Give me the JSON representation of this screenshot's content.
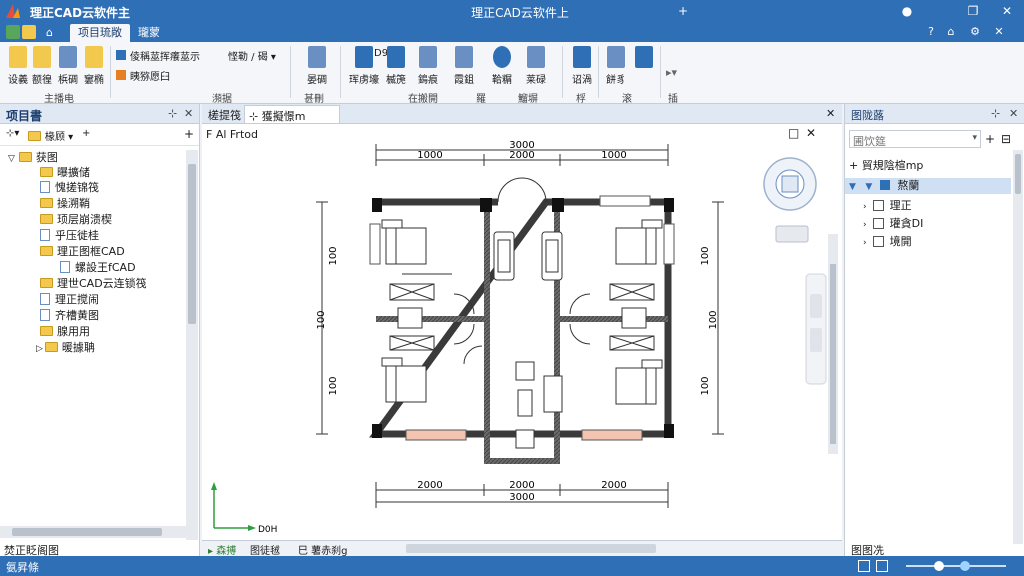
{
  "window": {
    "app_title": "理正CAD云软件主",
    "center_title": "理正CAD云软件上",
    "controls": {
      "pin": "+",
      "minimize": "●",
      "restore": "❐",
      "close": "✕"
    }
  },
  "tabs": {
    "home_icon": "⌂",
    "items": [
      "项目琉敞",
      "瓏蒙"
    ]
  },
  "ribbon": {
    "buttons": [
      {
        "label": "设義",
        "color": "#f2c94c"
      },
      {
        "label": "额徨",
        "color": "#f2c94c"
      },
      {
        "label": "梹碉",
        "color": "#6a8fc2"
      },
      {
        "label": "窶椭",
        "color": "#f2c94c"
      },
      {
        "label": "晏碉",
        "color": "#6a8fc2"
      },
      {
        "label": "珲虏壕",
        "color": "#2f6fb6"
      },
      {
        "label": "楲箎",
        "color": "#2f6fb6"
      },
      {
        "label": "鵭痕",
        "color": "#6a8fc2"
      },
      {
        "label": "霞鉏",
        "color": "#6a8fc2"
      },
      {
        "label": "鞈糏",
        "color": "#2f6fb6"
      },
      {
        "label": "莱碌",
        "color": "#6a8fc2"
      },
      {
        "label": "诏渦",
        "color": "#2f6fb6"
      },
      {
        "label": "餅豸",
        "color": "#6a8fc2"
      }
    ],
    "small_rows": [
      "倰稱莁挥癢莁示",
      "眱猕愿臼",
      "悭勒 / 碣 ▾",
      "D98"
    ],
    "groups": [
      "主播电",
      "瀕据",
      "甚刪",
      "在搬開",
      "羅",
      "鰡塀",
      "桴",
      "滚",
      "插"
    ]
  },
  "left_panel": {
    "title": "项目書",
    "toolbar_label": "椽顾",
    "tree": [
      {
        "label": "获图",
        "type": "folder",
        "depth": 0
      },
      {
        "label": "曝擴储",
        "type": "folder",
        "depth": 1
      },
      {
        "label": "愧搓锦筏",
        "type": "doc",
        "depth": 1
      },
      {
        "label": "操溯鞘",
        "type": "folder",
        "depth": 1
      },
      {
        "label": "顼层崩溃楔",
        "type": "folder",
        "depth": 1
      },
      {
        "label": "乎压徙桂",
        "type": "doc",
        "depth": 1
      },
      {
        "label": "理正图框CAD",
        "type": "folder",
        "depth": 1
      },
      {
        "label": "螺設王fCAD",
        "type": "doc",
        "depth": 2
      },
      {
        "label": "理世CAD云连锁筏",
        "type": "folder",
        "depth": 1
      },
      {
        "label": "理正搅闹",
        "type": "doc",
        "depth": 1
      },
      {
        "label": "齐槽黄图",
        "type": "doc",
        "depth": 1
      },
      {
        "label": "腺用用",
        "type": "folder",
        "depth": 1
      },
      {
        "label": "暖據聃",
        "type": "folder",
        "depth": 1
      }
    ],
    "footer_label": "焚正眨阁图"
  },
  "drawing": {
    "doc_tab_label": "槎提筏",
    "doc_tab_file": "⊹ 獲擬憬m",
    "view_label": "F Al Frtod",
    "dims_top": {
      "total": "3000",
      "left": "1000",
      "mid": "2000",
      "right": "1000"
    },
    "dims_bottom": {
      "left": "2000",
      "mid": "2000",
      "total": "3000"
    },
    "dims_left": [
      "100",
      "100",
      "100"
    ],
    "dims_right": [
      "100",
      "100",
      "100"
    ],
    "axis_label": "D0H",
    "bottom_tabs": [
      "▸ 森搏",
      "图徒毧",
      "巳 薯赤刹g"
    ],
    "canvas_controls": {
      "print": "□",
      "close": "✕"
    }
  },
  "right_panel": {
    "title": "图陇蕗",
    "search_placeholder": "圃饮筵",
    "layer_root": "+ 貿規陰楦mp",
    "layer_group": "熬蘭",
    "layers": [
      "理正",
      "瓘貪DI",
      "境開"
    ],
    "footer_label": "图图冼"
  },
  "status": {
    "left": "氨昇條"
  },
  "colors": {
    "accent": "#2f6fb6",
    "wall": "#4a4a4a",
    "window_fill": "#f3c4b0"
  }
}
